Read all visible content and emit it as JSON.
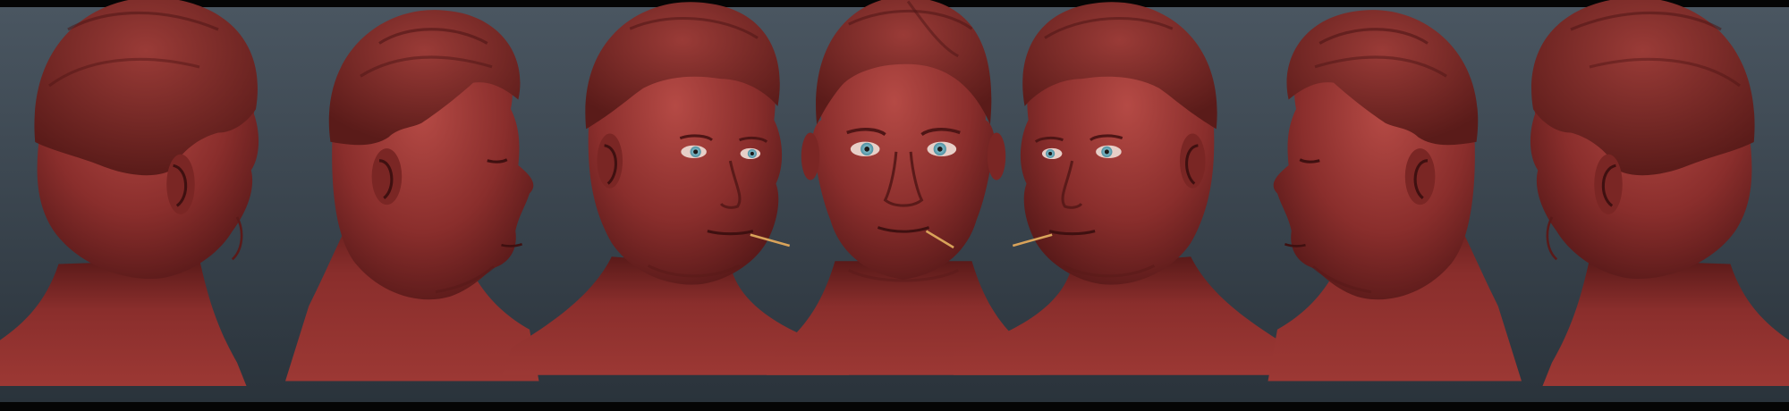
{
  "image": {
    "description_kind": "turnaround-render",
    "view_count": 7,
    "views": [
      {
        "id": "back-three-quarter-right",
        "facing": "right",
        "turn": "back"
      },
      {
        "id": "profile-right",
        "facing": "right",
        "turn": "profile"
      },
      {
        "id": "three-quarter-right",
        "facing": "right",
        "turn": "three-quarter"
      },
      {
        "id": "front",
        "facing": "front",
        "turn": "front"
      },
      {
        "id": "three-quarter-left",
        "facing": "left",
        "turn": "three-quarter"
      },
      {
        "id": "profile-left",
        "facing": "left",
        "turn": "profile"
      },
      {
        "id": "back-three-quarter-left",
        "facing": "left",
        "turn": "back"
      }
    ],
    "colors": {
      "background_top": "#4a5661",
      "background_bottom": "#2a333b",
      "letterbox": "#050505",
      "clay_base": "#8a2e2c",
      "clay_light": "#b54a45",
      "clay_dark": "#4e1515",
      "clay_hair": "#7a2a27",
      "eye_iris": "#6fb3c4",
      "toothpick": "#d9a35a"
    }
  }
}
